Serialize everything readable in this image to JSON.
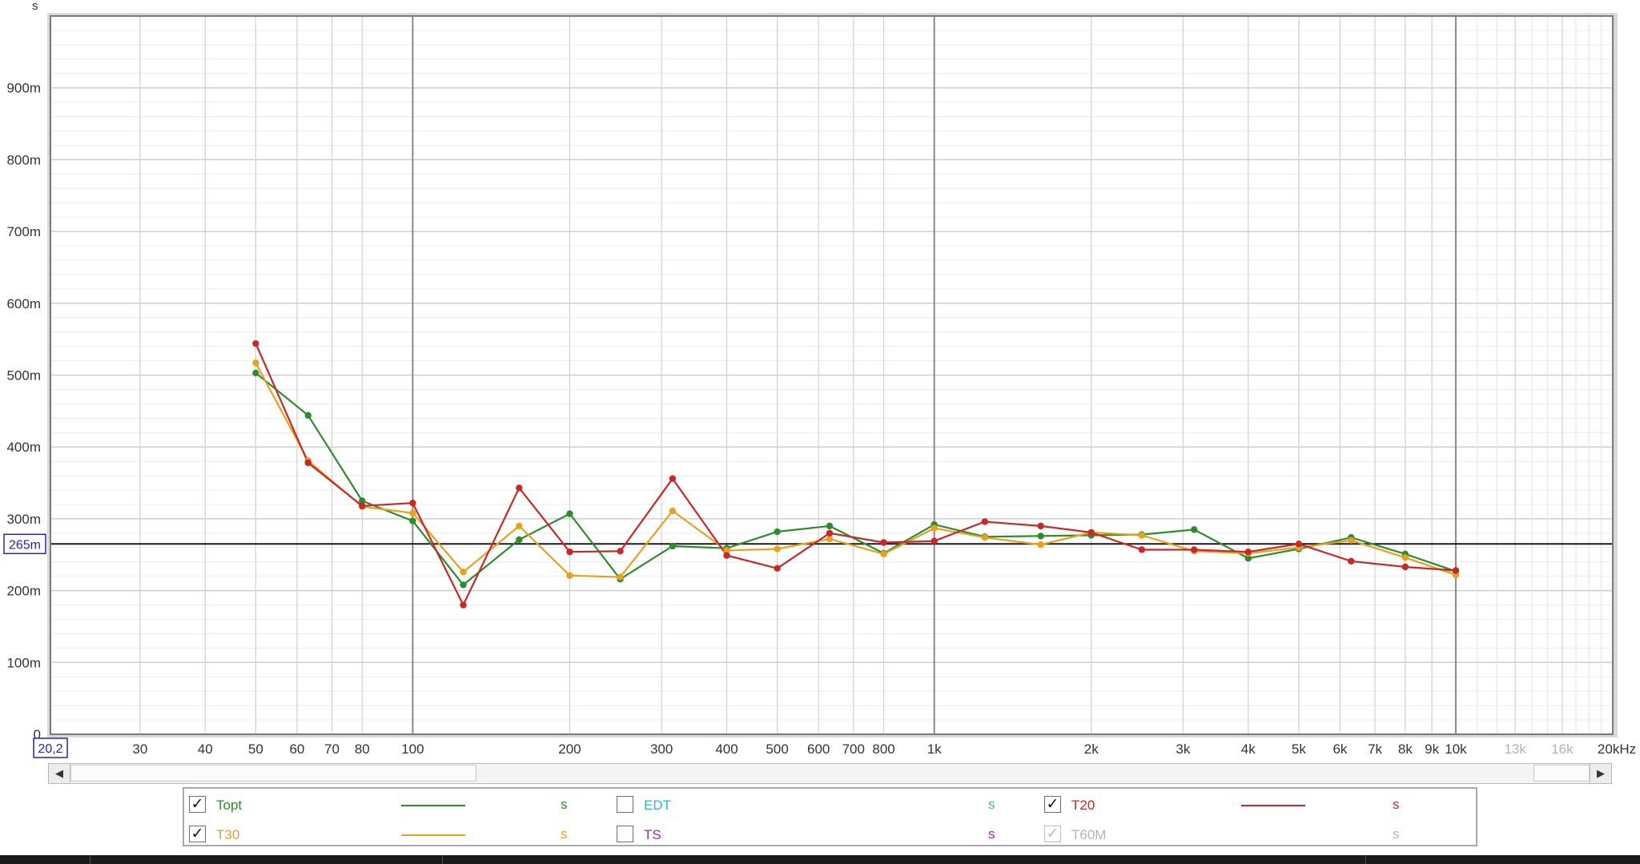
{
  "chart_data": {
    "type": "line",
    "y_unit_label": "s",
    "x_unit_label": "kHz",
    "x_scale": "log",
    "xlim": [
      20.2,
      20000
    ],
    "ylim": [
      0,
      1.0
    ],
    "grid": true,
    "cursor": {
      "value": 0.265,
      "label": "265m",
      "color": "#2222cc"
    },
    "x_start_label": "20,2",
    "y_ticks": [
      {
        "value": 0,
        "label": "0"
      },
      {
        "value": 0.1,
        "label": "100m"
      },
      {
        "value": 0.2,
        "label": "200m"
      },
      {
        "value": 0.3,
        "label": "300m"
      },
      {
        "value": 0.4,
        "label": "400m"
      },
      {
        "value": 0.5,
        "label": "500m"
      },
      {
        "value": 0.6,
        "label": "600m"
      },
      {
        "value": 0.7,
        "label": "700m"
      },
      {
        "value": 0.8,
        "label": "800m"
      },
      {
        "value": 0.9,
        "label": "900m"
      }
    ],
    "x_ticks": [
      {
        "value": 30,
        "label": "30",
        "active": true
      },
      {
        "value": 40,
        "label": "40",
        "active": true
      },
      {
        "value": 50,
        "label": "50",
        "active": true
      },
      {
        "value": 60,
        "label": "60",
        "active": true
      },
      {
        "value": 70,
        "label": "70",
        "active": true
      },
      {
        "value": 80,
        "label": "80",
        "active": true
      },
      {
        "value": 100,
        "label": "100",
        "active": true
      },
      {
        "value": 200,
        "label": "200",
        "active": true
      },
      {
        "value": 300,
        "label": "300",
        "active": true
      },
      {
        "value": 400,
        "label": "400",
        "active": true
      },
      {
        "value": 500,
        "label": "500",
        "active": true
      },
      {
        "value": 600,
        "label": "600",
        "active": true
      },
      {
        "value": 700,
        "label": "700",
        "active": true
      },
      {
        "value": 800,
        "label": "800",
        "active": true
      },
      {
        "value": 1000,
        "label": "1k",
        "active": true
      },
      {
        "value": 2000,
        "label": "2k",
        "active": true
      },
      {
        "value": 3000,
        "label": "3k",
        "active": true
      },
      {
        "value": 4000,
        "label": "4k",
        "active": true
      },
      {
        "value": 5000,
        "label": "5k",
        "active": true
      },
      {
        "value": 6000,
        "label": "6k",
        "active": true
      },
      {
        "value": 7000,
        "label": "7k",
        "active": true
      },
      {
        "value": 8000,
        "label": "8k",
        "active": true
      },
      {
        "value": 9000,
        "label": "9k",
        "active": true
      },
      {
        "value": 10000,
        "label": "10k",
        "active": true
      },
      {
        "value": 13000,
        "label": "13k",
        "active": false
      },
      {
        "value": 16000,
        "label": "16k",
        "active": false
      },
      {
        "value": 20000,
        "label": "20kHz",
        "active": true
      }
    ],
    "x": [
      50,
      63,
      80,
      100,
      125,
      160,
      200,
      250,
      315,
      400,
      500,
      630,
      800,
      1000,
      1250,
      1600,
      2000,
      2500,
      3150,
      4000,
      5000,
      6300,
      8000,
      10000
    ],
    "series": [
      {
        "name": "Topt",
        "color": "#2e8b2e",
        "values": [
          0.503,
          0.444,
          0.325,
          0.297,
          0.208,
          0.271,
          0.307,
          0.216,
          0.262,
          0.259,
          0.282,
          0.29,
          0.252,
          0.292,
          0.275,
          0.276,
          0.277,
          0.278,
          0.285,
          0.245,
          0.258,
          0.274,
          0.251,
          0.227
        ]
      },
      {
        "name": "T30",
        "color": "#e8a020",
        "values": [
          0.517,
          0.381,
          0.317,
          0.308,
          0.226,
          0.29,
          0.221,
          0.219,
          0.311,
          0.256,
          0.258,
          0.272,
          0.251,
          0.287,
          0.274,
          0.264,
          0.281,
          0.277,
          0.255,
          0.252,
          0.26,
          0.27,
          0.246,
          0.222
        ]
      },
      {
        "name": "T20",
        "color": "#c82828",
        "values": [
          0.544,
          0.378,
          0.318,
          0.322,
          0.18,
          0.343,
          0.254,
          0.255,
          0.356,
          0.249,
          0.231,
          0.28,
          0.267,
          0.269,
          0.296,
          0.29,
          0.281,
          0.257,
          0.257,
          0.254,
          0.265,
          0.241,
          0.233,
          0.228
        ]
      }
    ]
  },
  "legend": {
    "items": [
      {
        "name": "Topt",
        "checked": true,
        "enabled": true,
        "color": "#2e8b2e",
        "unit": "s",
        "unit_color": "#2e8b2e",
        "has_line": true
      },
      {
        "name": "EDT",
        "checked": false,
        "enabled": true,
        "color": "#2fb5c8",
        "unit": "s",
        "unit_color": "#2fb5c8",
        "has_line": false
      },
      {
        "name": "T20",
        "checked": true,
        "enabled": true,
        "color": "#c82828",
        "unit": "s",
        "unit_color": "#c82828",
        "has_line": true
      },
      {
        "name": "T30",
        "checked": true,
        "enabled": true,
        "color": "#e8a020",
        "unit": "s",
        "unit_color": "#e8a020",
        "has_line": true
      },
      {
        "name": "TS",
        "checked": false,
        "enabled": true,
        "color": "#9b2aa8",
        "unit": "s",
        "unit_color": "#9b2aa8",
        "has_line": false
      },
      {
        "name": "T60M",
        "checked": true,
        "enabled": false,
        "color": "#b5b5b5",
        "unit": "s",
        "unit_color": "#b5b5b5",
        "has_line": false
      }
    ]
  },
  "scrollbar": {
    "left_icon": "arrow-left-icon",
    "right_icon": "arrow-right-icon",
    "left_glyph": "◀",
    "right_glyph": "▶"
  },
  "checkmark_glyph": "✓"
}
